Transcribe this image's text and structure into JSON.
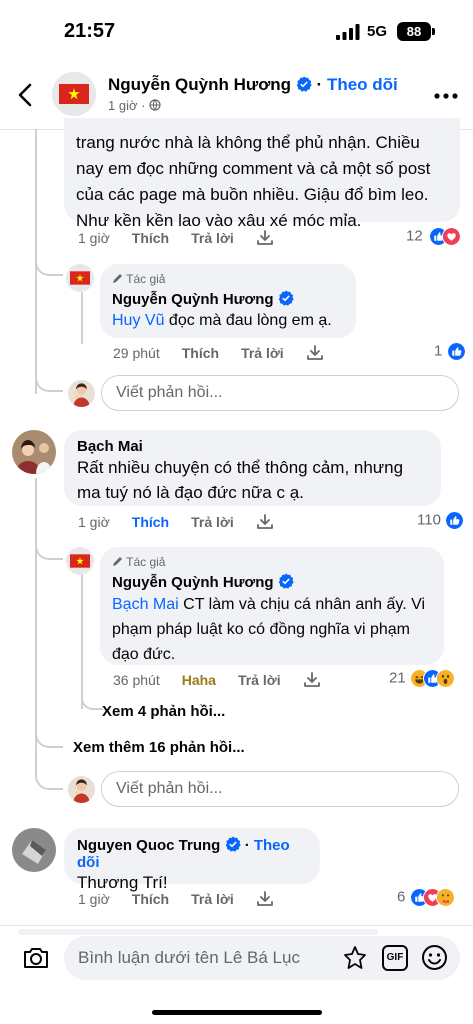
{
  "status_bar": {
    "time": "21:57",
    "network": "5G",
    "battery": "88"
  },
  "header": {
    "name": "Nguyễn Quỳnh Hương",
    "follow": "Theo dõi",
    "time": "1 giờ ·"
  },
  "comment1": {
    "text": "trang nước nhà là không thể phủ nhận. Chiều nay em đọc những comment và cả một số post của các page mà buồn nhiều. Giậu đổ bìm leo. Như kền kền lao vào xâu xé móc mỉa.",
    "time": "1 giờ",
    "like": "Thích",
    "reply": "Trả lời",
    "reactions": "12"
  },
  "reply1": {
    "author_tag": "Tác giả",
    "author": "Nguyễn Quỳnh Hương",
    "mention": "Huy Vũ",
    "text": " đọc mà đau lòng em ạ.",
    "time": "29 phút",
    "like": "Thích",
    "reply": "Trả lời",
    "reactions": "1"
  },
  "reply_box_1": {
    "placeholder": "Viết phản hồi..."
  },
  "comment2": {
    "author": "Bạch Mai",
    "text": "Rất nhiều chuyện có thể thông cảm, nhưng ma tuý nó là đạo đức nữa c ạ.",
    "time": "1 giờ",
    "like": "Thích",
    "reply": "Trả lời",
    "reactions": "110"
  },
  "reply2": {
    "author_tag": "Tác giả",
    "author": "Nguyễn Quỳnh Hương",
    "mention": "Bạch Mai",
    "text": " CT làm và chịu cá nhân anh ấy. Vi phạm pháp luật ko có đồng nghĩa vi phạm đạo đức.",
    "time": "36 phút",
    "like": "Haha",
    "reply": "Trả lời",
    "reactions": "21"
  },
  "see_replies": "Xem 4 phản hồi...",
  "see_more_replies": "Xem thêm 16 phản hồi...",
  "reply_box_2": {
    "placeholder": "Viết phản hồi..."
  },
  "comment3": {
    "author": "Nguyen Quoc Trung",
    "follow": "Theo dõi",
    "text": "Thương Trí!",
    "time": "1 giờ",
    "like": "Thích",
    "reply": "Trả lời",
    "reactions": "6"
  },
  "bottom": {
    "placeholder": "Bình luận dưới tên Lê Bá Lục",
    "gif": "GIF"
  },
  "colors": {
    "accent": "#0866ff",
    "bubble": "#f0f2f5",
    "secondary_text": "#65676b",
    "love": "#f33e58",
    "haha": "#f7b125"
  }
}
